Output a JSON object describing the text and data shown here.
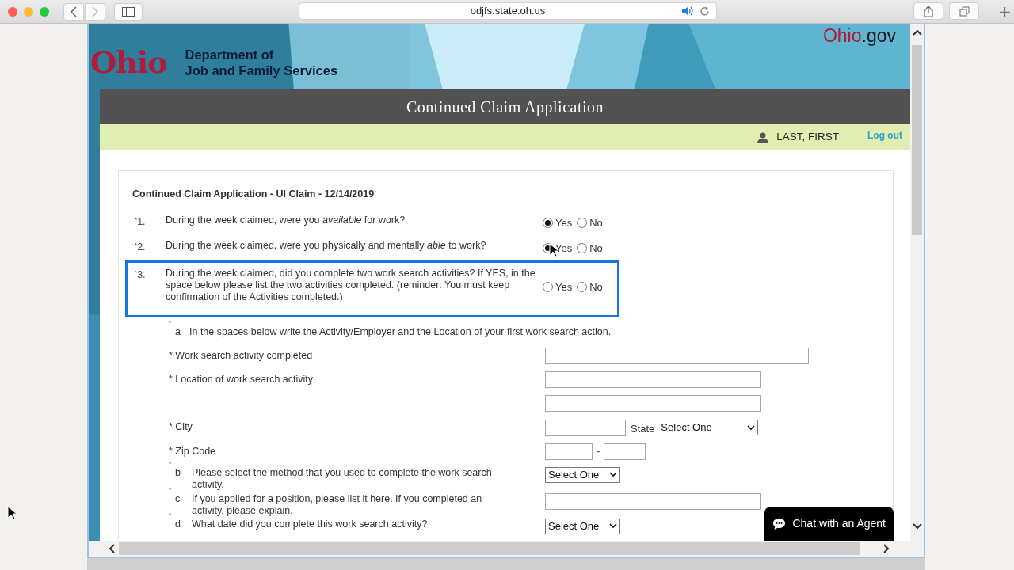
{
  "browser": {
    "url": "odjfs.state.oh.us"
  },
  "header": {
    "logo_mark": "Ohio",
    "department": [
      "Department of",
      "Job and Family Services"
    ],
    "portal": {
      "accent": "Ohio",
      "rest": ".gov"
    },
    "title": "Continued Claim Application"
  },
  "user_bar": {
    "user": "LAST, FIRST",
    "logout": "Log out"
  },
  "form": {
    "heading": "Continued Claim Application - UI Claim - 12/14/2019",
    "questions": [
      {
        "mark": "*",
        "number": "1.",
        "text": "During the week claimed, were you *available* for work?",
        "highlighted": false,
        "options": [
          {
            "label": "Yes",
            "selected": true
          },
          {
            "label": "No",
            "selected": false
          }
        ]
      },
      {
        "mark": "*",
        "number": "2.",
        "text": "During the week claimed, were you physically and mentally *able* to work?",
        "highlighted": false,
        "options": [
          {
            "label": "Yes",
            "selected": true
          },
          {
            "label": "No",
            "selected": false
          }
        ]
      },
      {
        "mark": "*",
        "number": "3.",
        "text": "During the week claimed, did you complete two work search activities? If YES, in the space below please list the two activities completed. (reminder: You must keep confirmation of the Activities completed.)",
        "highlighted": true,
        "options": [
          {
            "label": "Yes",
            "selected": false
          },
          {
            "label": "No",
            "selected": false
          }
        ]
      }
    ],
    "items": [
      {
        "kind": "note",
        "mark": "*",
        "letter": "a",
        "text": "In the spaces below write the Activity/Employer and the Location of your first work search action."
      },
      {
        "kind": "long_text",
        "label": "* Work search activity completed"
      },
      {
        "kind": "text",
        "label": "* Location of work search activity"
      },
      {
        "kind": "text"
      },
      {
        "kind": "city",
        "label": "* City",
        "state_label": "State",
        "state_value": "Select One"
      },
      {
        "kind": "zip",
        "label": "* Zip Code",
        "separator": "-"
      },
      {
        "kind": "select",
        "mark": "*",
        "letter": "b",
        "text": "Please select the method that you used to complete the work search activity.",
        "value": "Select One"
      },
      {
        "kind": "text",
        "mark": "*",
        "letter": "c",
        "text": "If you applied for a position, please list it here. If you completed an activity, please explain."
      },
      {
        "kind": "select",
        "mark": "*",
        "letter": "d",
        "text": "What date did you complete this work search activity?",
        "value": "Select One"
      }
    ]
  },
  "chat": {
    "label": "Chat with an Agent"
  }
}
